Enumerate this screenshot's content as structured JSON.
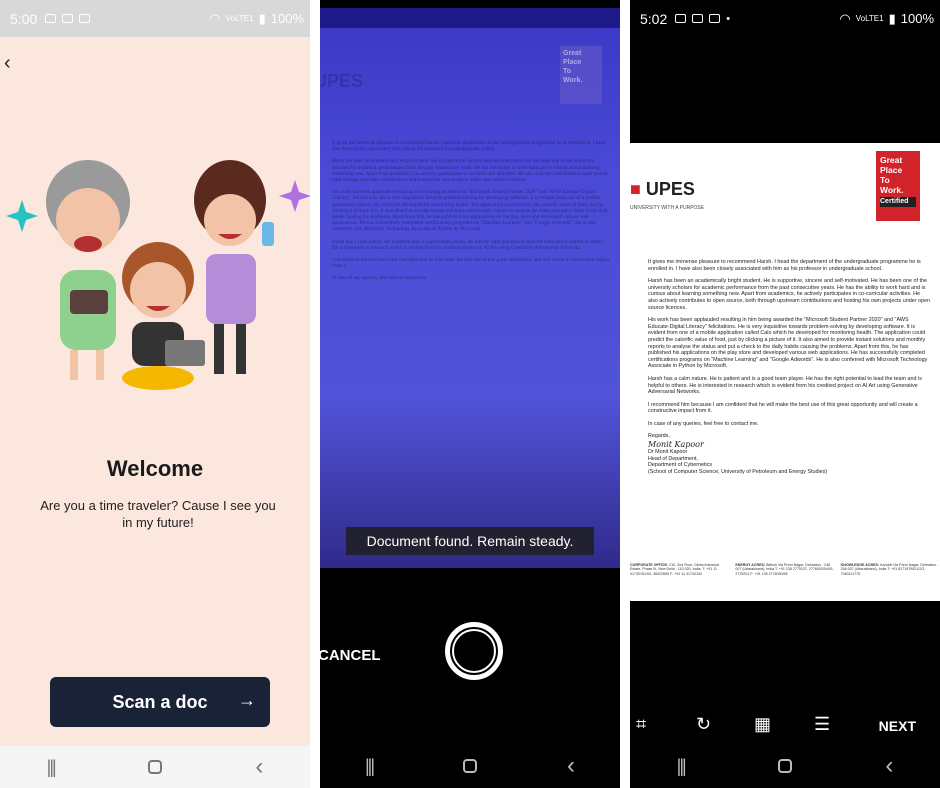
{
  "panel1": {
    "status": {
      "time": "5:00",
      "battery": "100%",
      "network": "VoLTE1"
    },
    "welcome_title": "Welcome",
    "tagline": "Are you a time traveler? Cause I see you in my future!",
    "scan_button": "Scan a doc",
    "scan_arrow": "→"
  },
  "panel2": {
    "toast": "Document found. Remain steady.",
    "cancel": "CANCEL"
  },
  "panel3": {
    "status": {
      "time": "5:02",
      "battery": "100%",
      "network": "VoLTE1"
    },
    "next": "NEXT"
  },
  "document": {
    "logo": "UPES",
    "logo_sub": "UNIVERSITY WITH A PURPOSE",
    "badge": {
      "line1": "Great",
      "line2": "Place",
      "line3": "To",
      "line4": "Work.",
      "certified": "Certified"
    },
    "paragraphs": [
      "It gives me immense pleasure to recommend Harsh. I head the department of the undergraduate programme he is enrolled in. I have also been closely associated with him as his professor in undergraduate school.",
      "Harsh has been an academically bright student. He is supportive, sincere and self-motivated. He has been one of the university scholars for academic performance from the past consecutive years. He has the ability to work hard and is curious about learning something new. Apart from academics, he actively participates in co-curricular activities. He also actively contributes to open source, both through upstream contributions and hosting his own projects under open source licences.",
      "His work has been applauded resulting in him being awarded the \"Microsoft Student Partner 2020\" and \"AWS Educate-Digital Literacy\" felicitations. He is very inquisitive towards problem-solving by developing software. It is evident from one of a mobile application called Calo which he developed for monitoring health. The application could predict the calorific value of food, just by clicking a picture of it. It also aimed to provide instant solutions and monthly reports to analyse the status and put a check to the daily habits causing the problems. Apart from this, he has published his applications on the play store and developed various web applications. He has successfully completed certifications programs on \"Machine Learning\" and \"Google Adwords\". He is also conferred with Microsoft Technology Associate in Python by Microsoft.",
      "Harsh has a calm nature. He is patient and is a good team player. He has the right potential to lead the team and is helpful to others. He is interested in research which is evident from his credited project on AI Art using Generative Adversarial Networks.",
      "I recommend him because I am confident that he will make the best use of this great opportunity and will create a constructive impact from it.",
      "In case of any queries, feel free to contact me."
    ],
    "regards": "Regards,",
    "signature": "Monit Kapoor",
    "name": "Dr Monit Kapoor",
    "role": "Head of Department,",
    "dept": "Department of Cybernetics",
    "school": "(School of Computer Science, University of Petroleum and Energy Studies)",
    "footer": [
      {
        "title": "CORPORATE OFFICE:",
        "text": "210, 2nd Floor, Okhla Industrial Estate, Phase III, New Delhi - 110 020, India. T: +91 11 41730151/53, 46022655 F: +91 11 41730154"
      },
      {
        "title": "ENERGY ACRES:",
        "text": "Bidholi Via Prem Nagar, Dehradun - 248 007 (Uttarakhand), India T: +91 135 2770137, 2776053/54/91, 2776201 F: +91 135 2776090/95"
      },
      {
        "title": "KNOWLEDGE ACRES:",
        "text": "Kandoli Via Prem Nagar, Dehradun - 248 007 (Uttarakhand), India T: +91 8171979021/2/3, 7060111775"
      }
    ]
  }
}
